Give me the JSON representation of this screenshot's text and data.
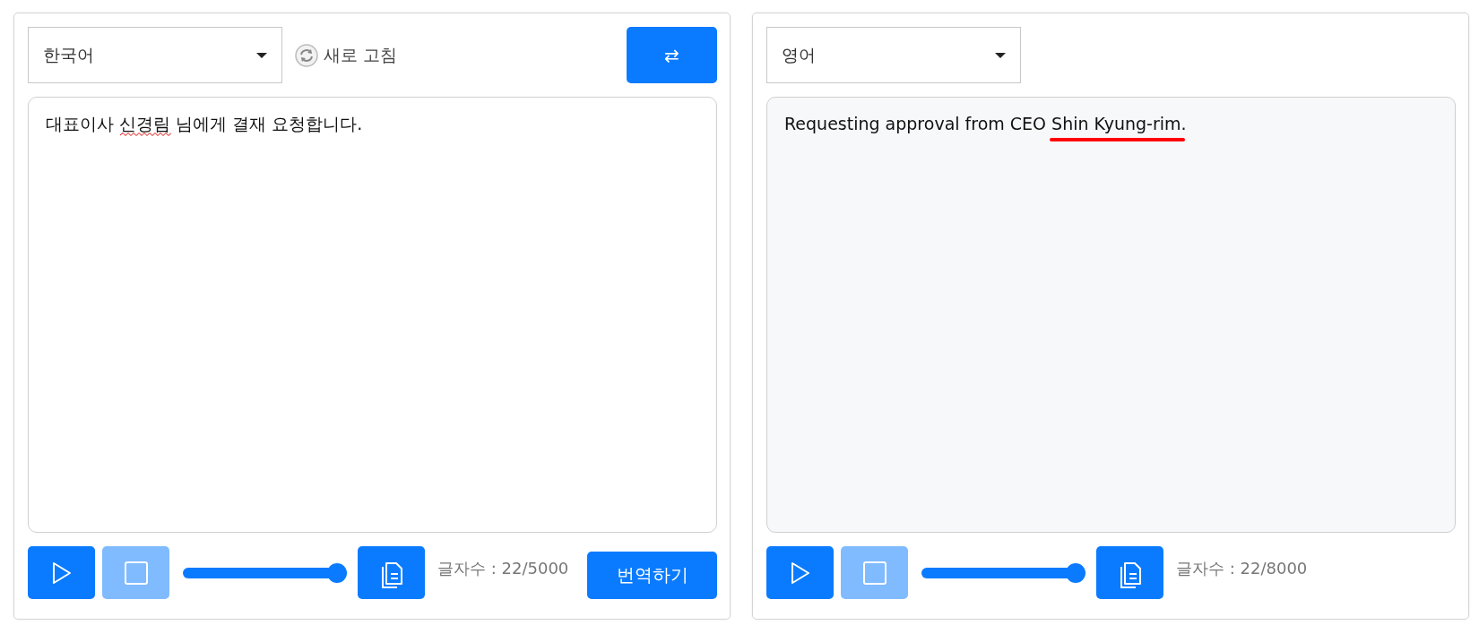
{
  "panels": [
    {
      "kind": "source",
      "language": "한국어",
      "refresh_label": "새로 고침",
      "swap_label": "⇄",
      "segments": [
        {
          "text": "대표이사 "
        },
        {
          "text": "신경림",
          "spelling_error": true
        },
        {
          "text": " 님에게 결재 요청합니다."
        }
      ],
      "play_disabled": false,
      "stop_disabled": true,
      "volume": {
        "level": 1
      },
      "char_count": "글자수 : 22/5000",
      "translate_label": "번역하기"
    },
    {
      "kind": "target",
      "language": "영어",
      "segments": [
        {
          "text": "Requesting approval from CEO "
        },
        {
          "text": "Shin Kyung-rim.",
          "underlined": true
        }
      ],
      "play_disabled": false,
      "stop_disabled": true,
      "volume": {
        "level": 1
      },
      "char_count": "글자수 : 22/8000"
    }
  ]
}
